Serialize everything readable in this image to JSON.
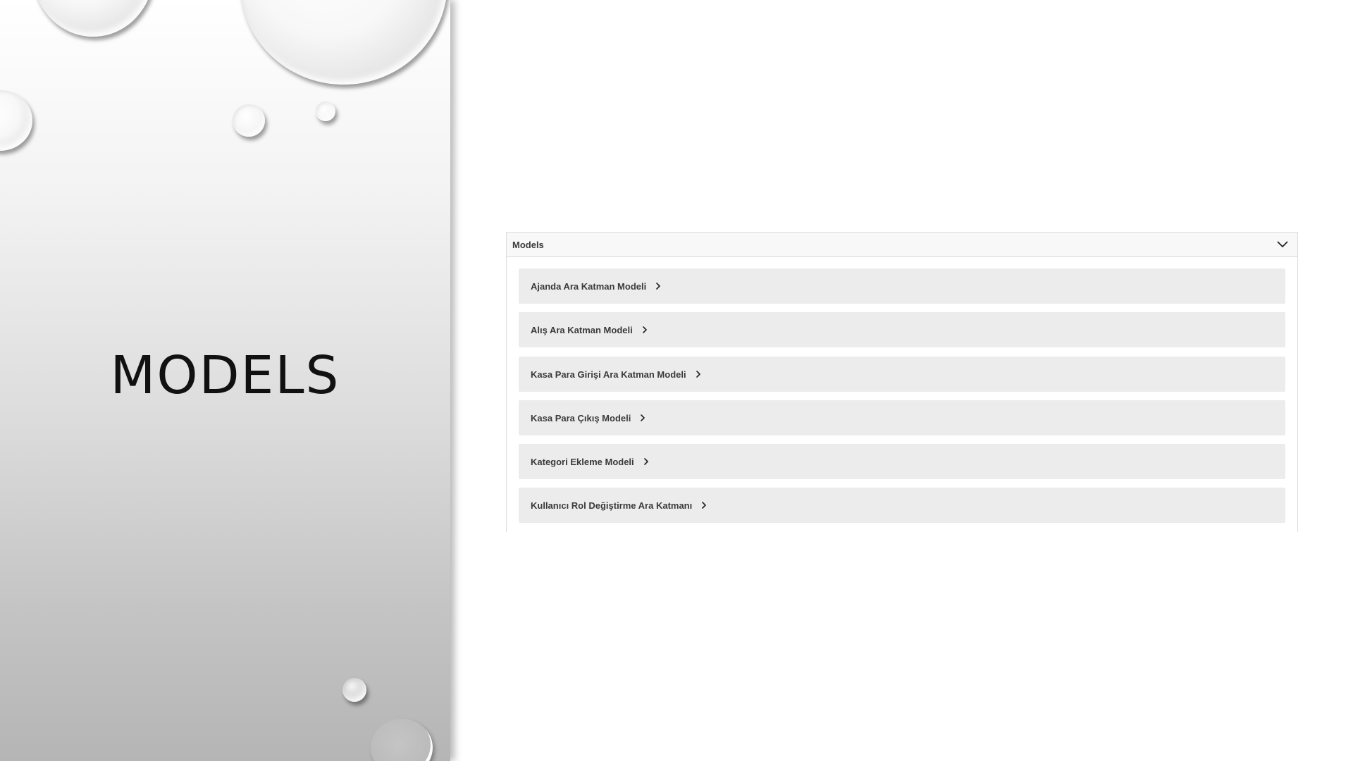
{
  "slide": {
    "title": "MODELS"
  },
  "models_panel": {
    "header": "Models",
    "expanded": true,
    "items": [
      {
        "label": "Ajanda Ara Katman Modeli"
      },
      {
        "label": "Alış Ara Katman Modeli"
      },
      {
        "label": "Kasa Para Girişi Ara Katman Modeli"
      },
      {
        "label": "Kasa Para Çıkış Modeli"
      },
      {
        "label": "Kategori Ekleme Modeli"
      },
      {
        "label": "Kullanıcı Rol Değiştirme Ara Katmanı"
      }
    ]
  },
  "icons": {
    "header_toggle": "chevron-down-icon",
    "item_expand": "chevron-right-icon"
  },
  "colors": {
    "panel_header_bg": "#f8f8f8",
    "item_bg": "#ececec",
    "text": "#3a3a3a",
    "title": "#111111"
  }
}
